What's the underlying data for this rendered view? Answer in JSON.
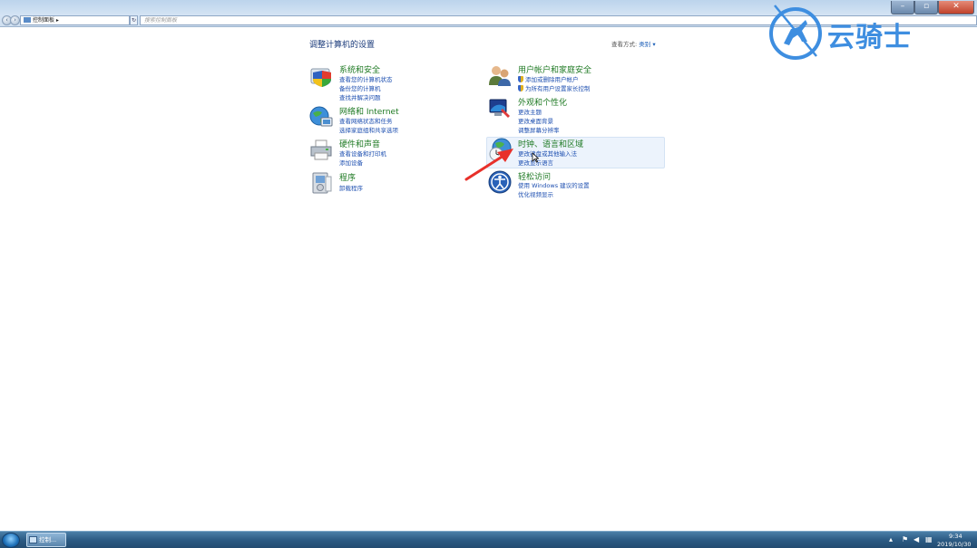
{
  "window": {
    "address": "控制面板",
    "search_placeholder": "搜索控制面板",
    "min_label": "–",
    "max_label": "▫",
    "close_label": "✕",
    "back_label": "‹",
    "forward_label": "›",
    "refresh_label": "↻"
  },
  "watermark": {
    "text": "云骑士"
  },
  "header": {
    "title": "调整计算机的设置",
    "view_by_label": "查看方式:",
    "view_by_value": "类别 ▾"
  },
  "categories": [
    {
      "title": "系统和安全",
      "links": [
        "查看您的计算机状态",
        "备份您的计算机",
        "查找并解决问题"
      ]
    },
    {
      "title": "网络和 Internet",
      "links": [
        "查看网络状态和任务",
        "选择家庭组和共享选项"
      ]
    },
    {
      "title": "硬件和声音",
      "links": [
        "查看设备和打印机",
        "添加设备"
      ]
    },
    {
      "title": "程序",
      "links": [
        "卸载程序"
      ]
    },
    {
      "title": "用户帐户和家庭安全",
      "links": [
        "添加或删除用户帐户",
        "为所有用户设置家长控制"
      ]
    },
    {
      "title": "外观和个性化",
      "links": [
        "更改主题",
        "更改桌面背景",
        "调整屏幕分辨率"
      ]
    },
    {
      "title": "时钟、语言和区域",
      "links": [
        "更改键盘或其他输入法",
        "更改显示语言"
      ]
    },
    {
      "title": "轻松访问",
      "links": [
        "使用 Windows 建议的设置",
        "优化视频显示"
      ]
    }
  ],
  "taskbar": {
    "task_label": "控制...",
    "time": "9:34",
    "date": "2019/10/30"
  },
  "colors": {
    "category_title": "#1f7a24",
    "link": "#1d4fb0",
    "annotation_arrow": "#e8302a"
  }
}
